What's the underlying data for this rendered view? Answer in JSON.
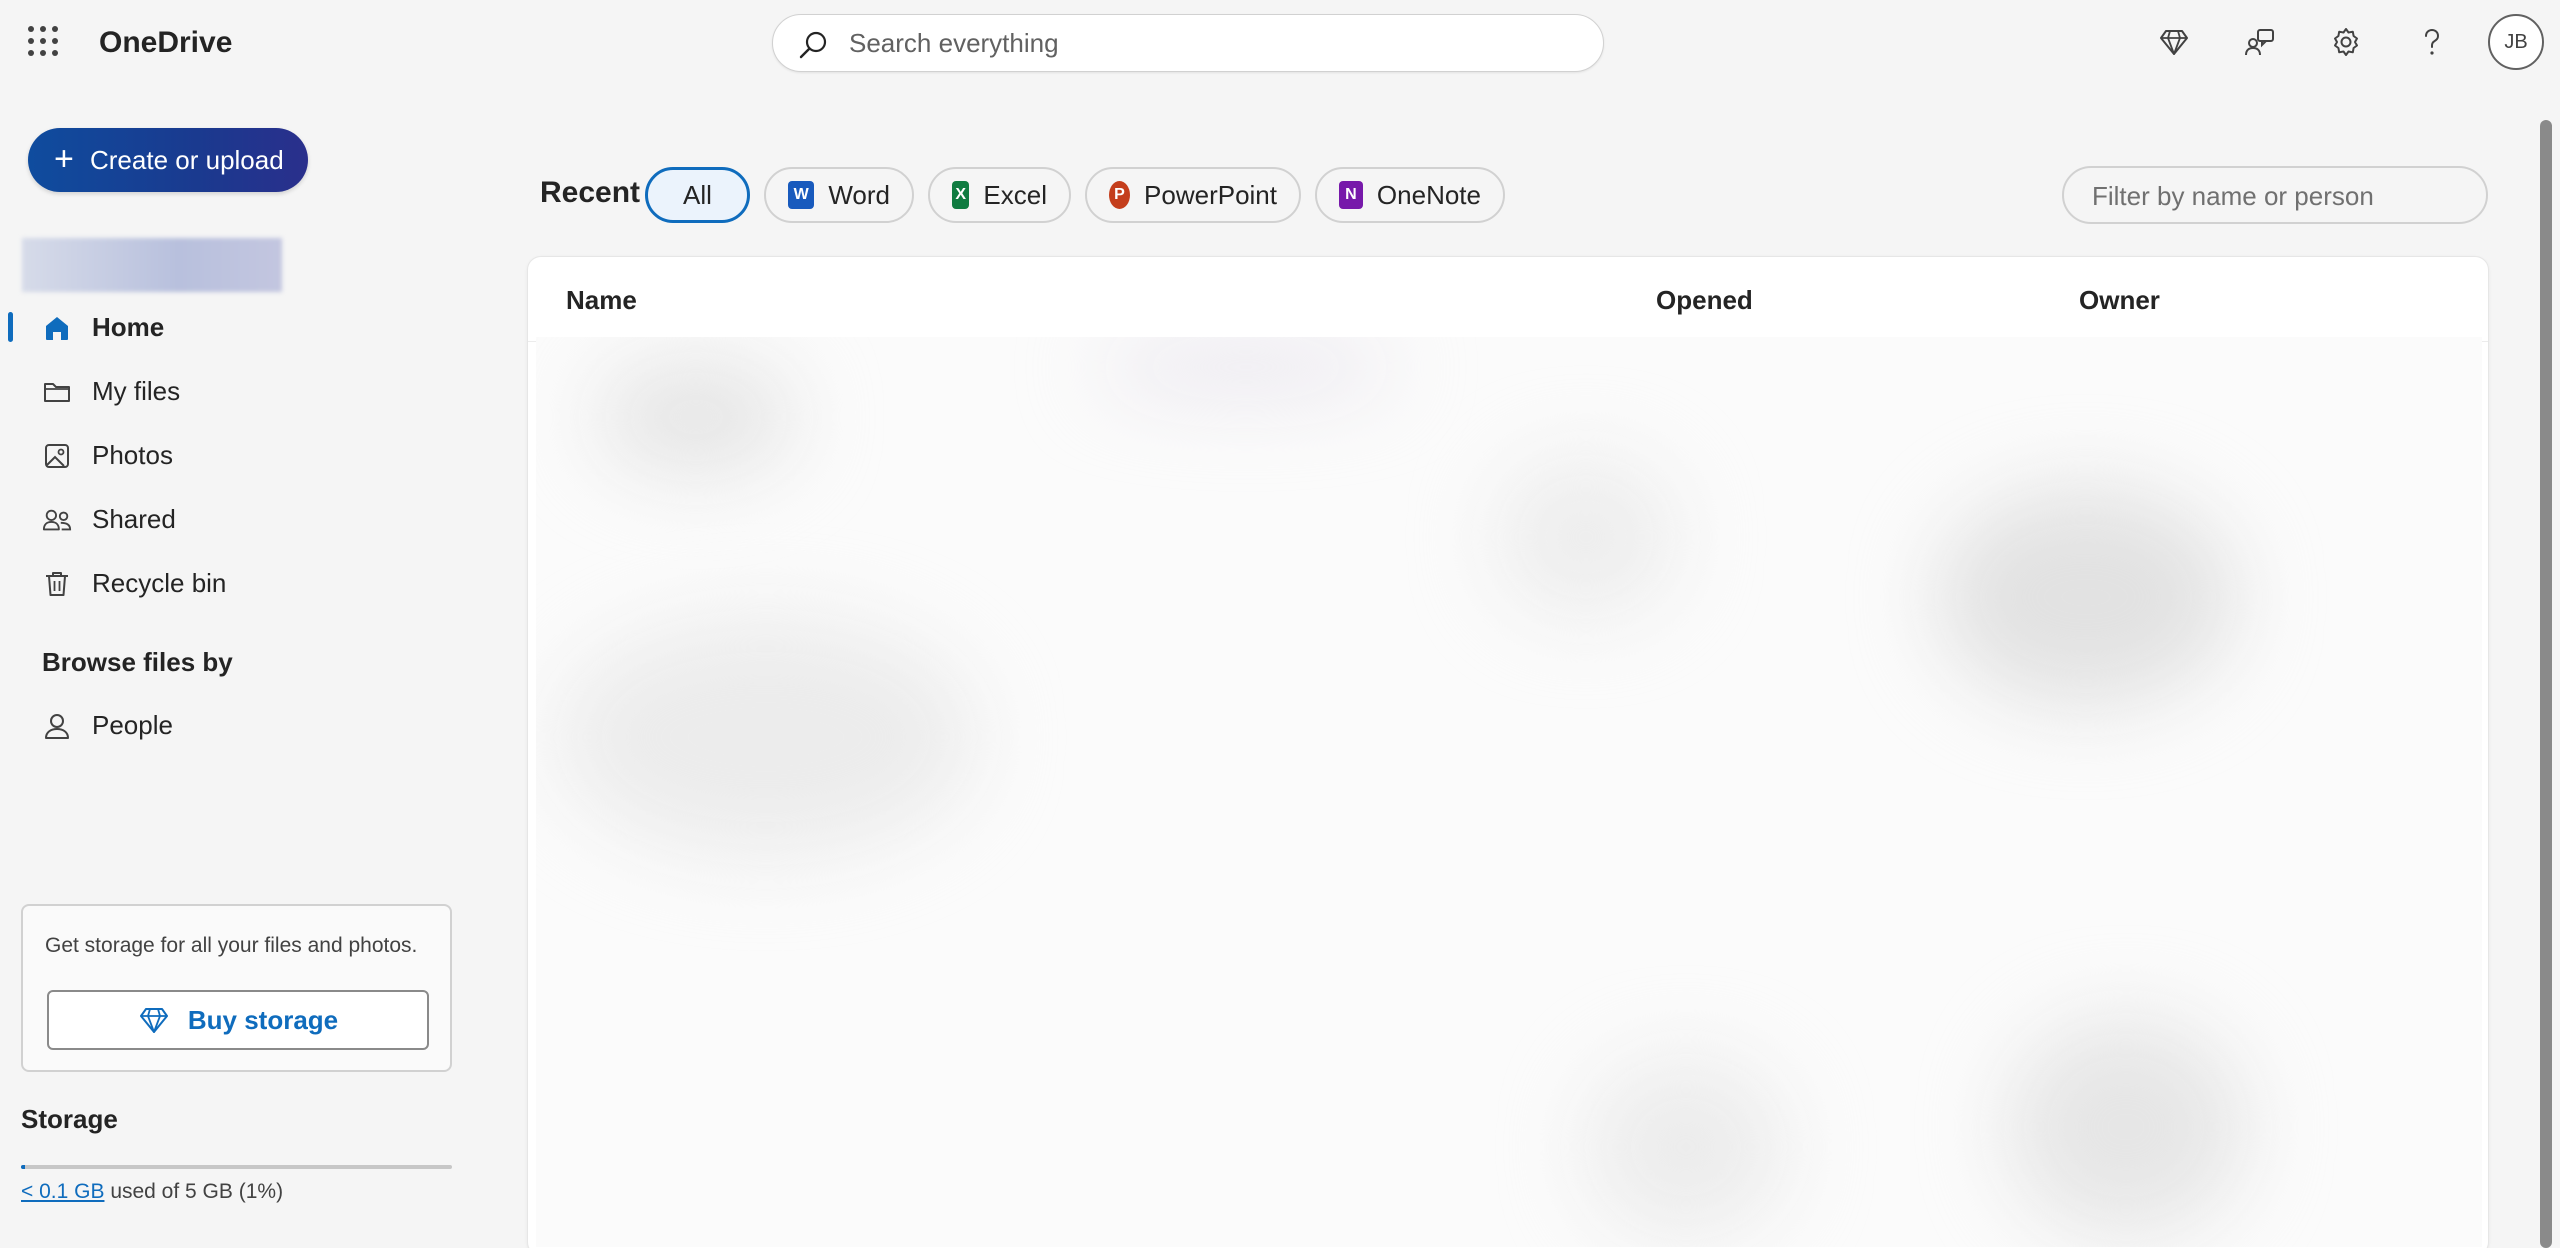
{
  "header": {
    "app_title": "OneDrive",
    "search_placeholder": "Search everything",
    "avatar_initials": "JB"
  },
  "sidebar": {
    "create_label": "Create or upload",
    "items": [
      {
        "label": "Home",
        "icon": "home-icon",
        "active": true
      },
      {
        "label": "My files",
        "icon": "folder-icon"
      },
      {
        "label": "Photos",
        "icon": "image-icon"
      },
      {
        "label": "Shared",
        "icon": "people-icon"
      },
      {
        "label": "Recycle bin",
        "icon": "trash-icon"
      }
    ],
    "browse_label": "Browse files by",
    "browse_items": [
      {
        "label": "People",
        "icon": "person-icon"
      }
    ],
    "storage_card": {
      "message": "Get storage for all your files and photos.",
      "buy_label": "Buy storage"
    },
    "storage": {
      "title": "Storage",
      "used_link": "< 0.1 GB",
      "used_text": "used of 5 GB (1%)",
      "used_fraction": 0.01
    }
  },
  "main": {
    "recent_label": "Recent",
    "filters": [
      {
        "label": "All",
        "selected": true
      },
      {
        "label": "Word",
        "icon": "word-icon",
        "color": "#185abd"
      },
      {
        "label": "Excel",
        "icon": "excel-icon",
        "color": "#107c41"
      },
      {
        "label": "PowerPoint",
        "icon": "powerpoint-icon",
        "color": "#c43e1c"
      },
      {
        "label": "OneNote",
        "icon": "onenote-icon",
        "color": "#7719aa"
      }
    ],
    "filter_placeholder": "Filter by name or person",
    "columns": [
      "Name",
      "Opened",
      "Owner"
    ]
  },
  "colors": {
    "accent": "#0f6cbd",
    "create_gradient_start": "#0f4c9e",
    "create_gradient_end": "#2a2f8c"
  }
}
